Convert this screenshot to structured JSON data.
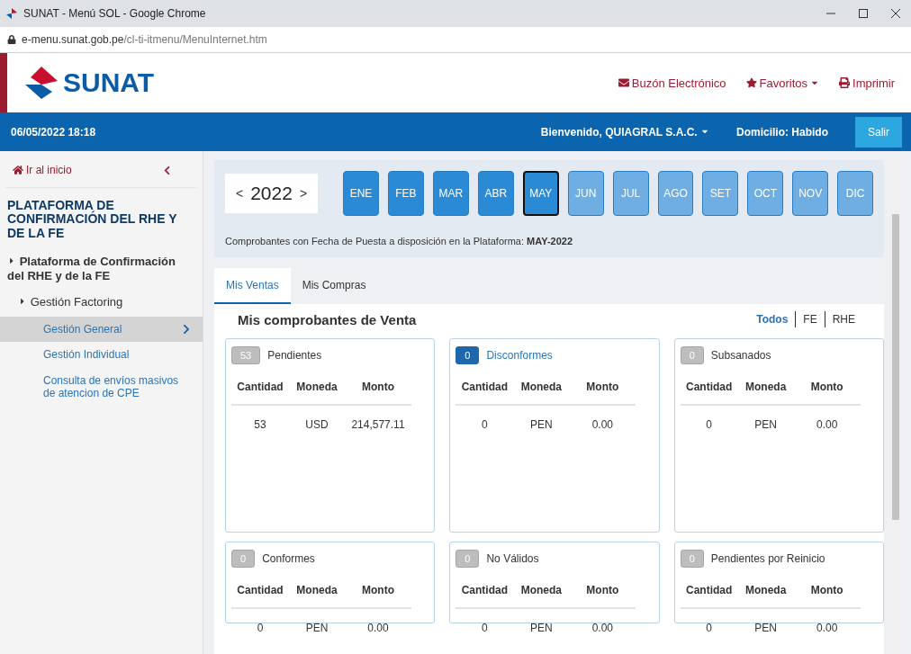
{
  "window": {
    "title": "SUNAT - Menú SOL - Google Chrome",
    "url_host": "e-menu.sunat.gob.pe",
    "url_path": "/cl-ti-itmenu/MenuInternet.htm"
  },
  "header": {
    "logo": "SUNAT",
    "links": [
      {
        "kind": "mail",
        "label": "Buzón Electrónico"
      },
      {
        "kind": "star",
        "label": "Favoritos",
        "dropdown": true
      },
      {
        "kind": "print",
        "label": "Imprimir"
      }
    ]
  },
  "topbar": {
    "datetime": "06/05/2022 18:18",
    "welcome": "Bienvenido, QUIAGRAL S.A.C.",
    "domicilio": "Domicilio: Habido",
    "logout": "Salir"
  },
  "sidebar": {
    "home": "Ir al inicio",
    "title": "PLATAFORMA DE CONFIRMACIÓN DEL RHE Y DE LA FE",
    "items": [
      {
        "label": "Plataforma de Confirmación del RHE y de la FE",
        "selected": false,
        "children": [
          {
            "label": "Gestión Factoring",
            "selected": false,
            "children": [
              {
                "label": "Gestión General",
                "selected": true
              },
              {
                "label": "Gestión Individual",
                "selected": false
              },
              {
                "label": "Consulta de envíos masivos de atencion de CPE",
                "selected": false
              }
            ]
          }
        ]
      }
    ]
  },
  "period": {
    "prev": "<",
    "year": "2022",
    "next": ">",
    "months": [
      {
        "label": "ENE",
        "enabled": true,
        "selected": false
      },
      {
        "label": "FEB",
        "enabled": true,
        "selected": false
      },
      {
        "label": "MAR",
        "enabled": true,
        "selected": false
      },
      {
        "label": "ABR",
        "enabled": true,
        "selected": false
      },
      {
        "label": "MAY",
        "enabled": true,
        "selected": true
      },
      {
        "label": "JUN",
        "enabled": false,
        "selected": false
      },
      {
        "label": "JUL",
        "enabled": false,
        "selected": false
      },
      {
        "label": "AGO",
        "enabled": false,
        "selected": false
      },
      {
        "label": "SET",
        "enabled": false,
        "selected": false
      },
      {
        "label": "OCT",
        "enabled": false,
        "selected": false
      },
      {
        "label": "NOV",
        "enabled": false,
        "selected": false
      },
      {
        "label": "DIC",
        "enabled": false,
        "selected": false
      }
    ],
    "note": "Comprobantes con Fecha de Puesta a disposición en la Plataforma: **MAY-2022**"
  },
  "tabs": [
    {
      "label": "Mis Ventas",
      "selected": true
    },
    {
      "label": "Mis Compras",
      "selected": false
    }
  ],
  "section": {
    "title": "Mis comprobantes de Venta",
    "filters": [
      {
        "label": "Todos",
        "selected": true
      },
      {
        "label": "FE",
        "selected": false
      },
      {
        "label": "RHE",
        "selected": false
      }
    ]
  },
  "cards": [
    {
      "count": "53",
      "title": "Pendientes",
      "active": false,
      "columns": [
        "Cantidad",
        "Moneda",
        "Monto"
      ],
      "rows": [
        [
          "53",
          "USD",
          "214,577.11"
        ]
      ]
    },
    {
      "count": "0",
      "title": "Disconformes",
      "active": true,
      "columns": [
        "Cantidad",
        "Moneda",
        "Monto"
      ],
      "rows": [
        [
          "0",
          "PEN",
          "0.00"
        ]
      ]
    },
    {
      "count": "0",
      "title": "Subsanados",
      "active": false,
      "columns": [
        "Cantidad",
        "Moneda",
        "Monto"
      ],
      "rows": [
        [
          "0",
          "PEN",
          "0.00"
        ]
      ]
    },
    {
      "count": "0",
      "title": "Conformes",
      "active": false,
      "columns": [
        "Cantidad",
        "Moneda",
        "Monto"
      ],
      "rows": [
        [
          "0",
          "PEN",
          "0.00"
        ]
      ]
    },
    {
      "count": "0",
      "title": "No Válidos",
      "active": false,
      "columns": [
        "Cantidad",
        "Moneda",
        "Monto"
      ],
      "rows": [
        [
          "0",
          "PEN",
          "0.00"
        ]
      ]
    },
    {
      "count": "0",
      "title": "Pendientes por Reinicio",
      "active": false,
      "columns": [
        "Cantidad",
        "Moneda",
        "Monto"
      ],
      "rows": [
        [
          "0",
          "PEN",
          "0.00"
        ]
      ]
    }
  ]
}
